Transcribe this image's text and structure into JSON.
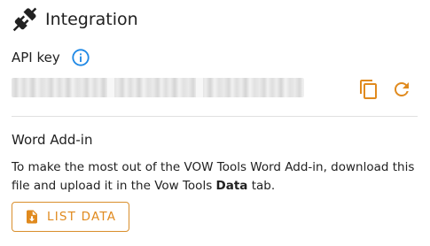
{
  "header": {
    "title": "Integration",
    "icon": "plug-icon"
  },
  "api": {
    "label": "API key",
    "info_icon": "info-icon",
    "copy_icon": "copy-icon",
    "refresh_icon": "refresh-icon"
  },
  "word_addin": {
    "title": "Word Add-in",
    "desc_part1": "To make the most out of the VOW Tools Word Add-in, download this file and upload it in the Vow Tools ",
    "desc_bold": "Data",
    "desc_part2": " tab.",
    "button_label": "LIST DATA",
    "button_icon": "download-file-icon"
  },
  "colors": {
    "accent": "#e08a1e",
    "info": "#1e88e5",
    "text": "#212121",
    "divider": "#e0e0e0"
  }
}
